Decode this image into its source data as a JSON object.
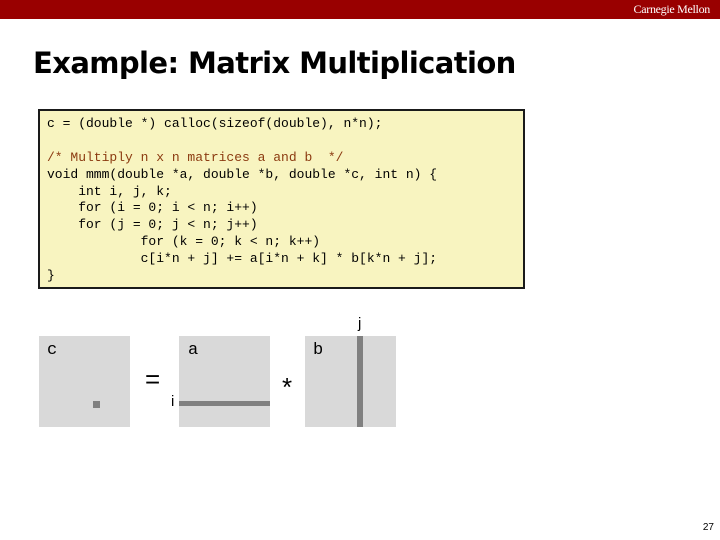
{
  "header": {
    "brand": "Carnegie Mellon",
    "bar_color": "#990000"
  },
  "slide": {
    "title": "Example: Matrix Multiplication",
    "page_number": "27"
  },
  "code": {
    "background": "#f8f4c0",
    "lines": [
      {
        "text": "c = (double *) calloc(sizeof(double), n*n);",
        "type": "code"
      },
      {
        "text": "",
        "type": "blank"
      },
      {
        "text": "/* Multiply n x n matrices a and b  */",
        "type": "comment"
      },
      {
        "text": "void mmm(double *a, double *b, double *c, int n) {",
        "type": "code"
      },
      {
        "text": "    int i, j, k;",
        "type": "code"
      },
      {
        "text": "    for (i = 0; i < n; i++)",
        "type": "code"
      },
      {
        "text": "    for (j = 0; j < n; j++)",
        "type": "code"
      },
      {
        "text": "            for (k = 0; k < n; k++)",
        "type": "code"
      },
      {
        "text": "            c[i*n + j] += a[i*n + k] * b[k*n + j];",
        "type": "code"
      },
      {
        "text": "}",
        "type": "code"
      }
    ]
  },
  "diagram": {
    "matrix_c_label": "c",
    "matrix_a_label": "a",
    "matrix_b_label": "b",
    "equals": "=",
    "times": "*",
    "row_index": "i",
    "col_index": "j"
  }
}
